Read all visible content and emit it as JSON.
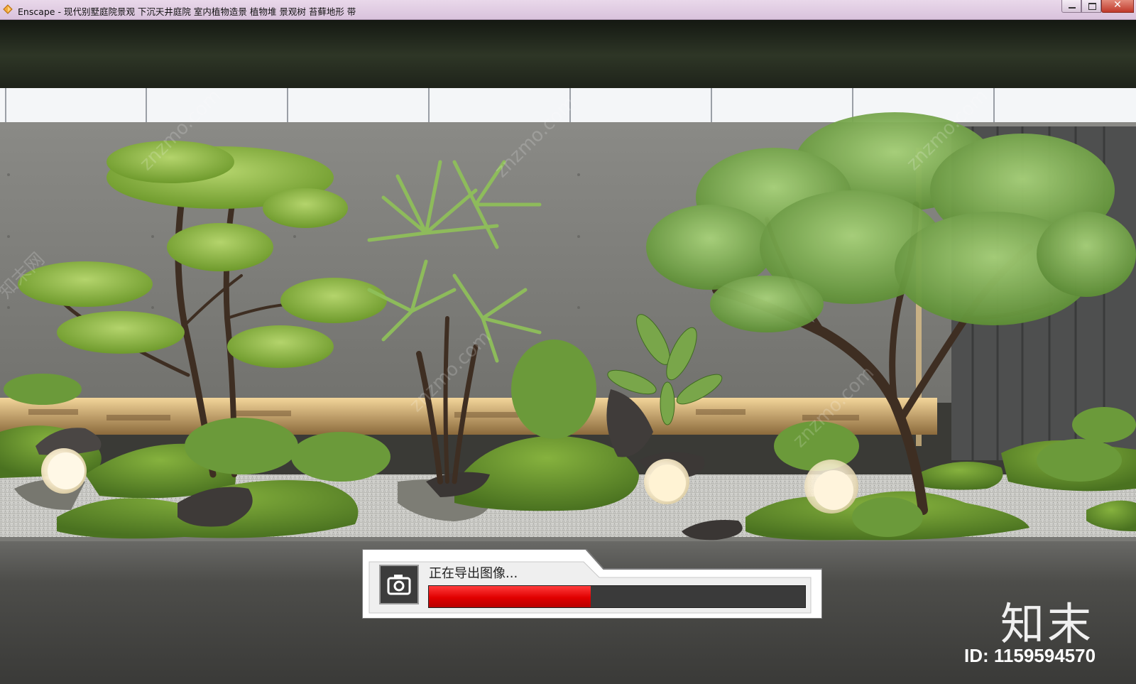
{
  "window": {
    "title": "Enscape - 现代别墅庭院景观 下沉天井庭院 室内植物造景 植物堆 景观树 苔藓地形 带",
    "controls": {
      "minimize": "minimize",
      "maximize": "maximize",
      "close": "✕"
    }
  },
  "export_dialog": {
    "label": "正在导出图像...",
    "progress_percent": 43,
    "progress_color": "#e60000",
    "icon": "camera-icon"
  },
  "watermark": {
    "brand": "知末",
    "id_text": "ID: 1159594570",
    "site": "znzmo.com",
    "site_cn": "知末网"
  },
  "scene": {
    "description_icon": "render-preview",
    "colors": {
      "wall": "#7c7c78",
      "moss": "#5f8a2a",
      "gravel": "#c9c9c4",
      "road": "#4b4b48"
    }
  }
}
